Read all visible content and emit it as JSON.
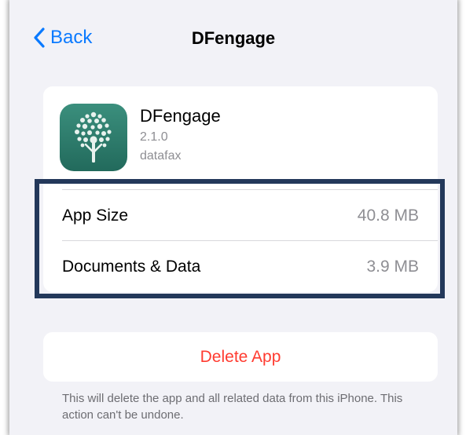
{
  "nav": {
    "back_label": "Back",
    "title": "DFengage",
    "back_icon": "chevron-left-icon"
  },
  "app": {
    "name": "DFengage",
    "version": "2.1.0",
    "developer": "datafax",
    "icon": "tree-icon",
    "icon_color": "#2f7e6e"
  },
  "storage": {
    "rows": [
      {
        "label": "App Size",
        "value": "40.8 MB"
      },
      {
        "label": "Documents & Data",
        "value": "3.9 MB"
      }
    ]
  },
  "actions": {
    "delete_label": "Delete App",
    "delete_color": "#ff3b30"
  },
  "footer": {
    "text": "This will delete the app and all related data from this iPhone. This action can't be undone."
  },
  "colors": {
    "accent": "#0a7aff",
    "highlight_border": "#23385a",
    "background": "#f2f2f7"
  }
}
